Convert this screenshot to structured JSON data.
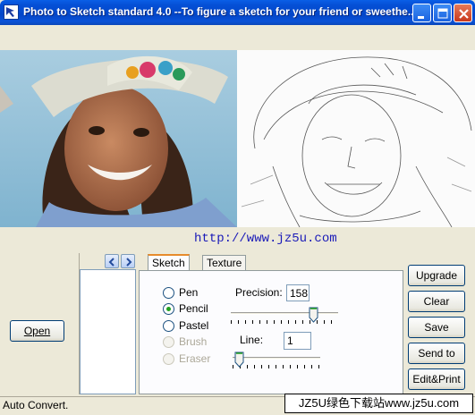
{
  "window": {
    "title": "Photo to Sketch standard 4.0 --To figure a sketch for your friend or sweethe...",
    "icon": "app-arrow-icon",
    "controls": [
      "minimize-icon",
      "maximize-icon",
      "close-icon"
    ]
  },
  "images": {
    "original": "photo of smiling woman in hat",
    "sketch": "pencil sketch of same woman"
  },
  "url": "http://www.jz5u.com",
  "left_panel": {
    "open_label": "Open",
    "nav_left_icon": "chevron-left-icon",
    "nav_right_icon": "chevron-right-icon"
  },
  "tabs": [
    {
      "label": "Sketch",
      "active": true
    },
    {
      "label": "Texture",
      "active": false
    }
  ],
  "sketch_tab": {
    "tools": [
      {
        "label": "Pen",
        "checked": false,
        "disabled": false
      },
      {
        "label": "Pencil",
        "checked": true,
        "disabled": false
      },
      {
        "label": "Pastel",
        "checked": false,
        "disabled": false
      },
      {
        "label": "Brush",
        "checked": false,
        "disabled": true
      },
      {
        "label": "Eraser",
        "checked": false,
        "disabled": true
      }
    ],
    "precision_label": "Precision:",
    "precision_value": "158",
    "line_label": "Line:",
    "line_value": "1"
  },
  "actions": {
    "upgrade": "Upgrade",
    "clear": "Clear",
    "save": "Save",
    "send_to": "Send to",
    "edit_print": "Edit&Print"
  },
  "status": {
    "text": "Auto Convert.",
    "watermark": "JZ5U绿色下载站www.jz5u.com"
  },
  "colors": {
    "titlebar": "#0550d6",
    "url_text": "#1a1ab8",
    "radio_checked": "#21a121",
    "tab_accent": "#e68b2c"
  }
}
